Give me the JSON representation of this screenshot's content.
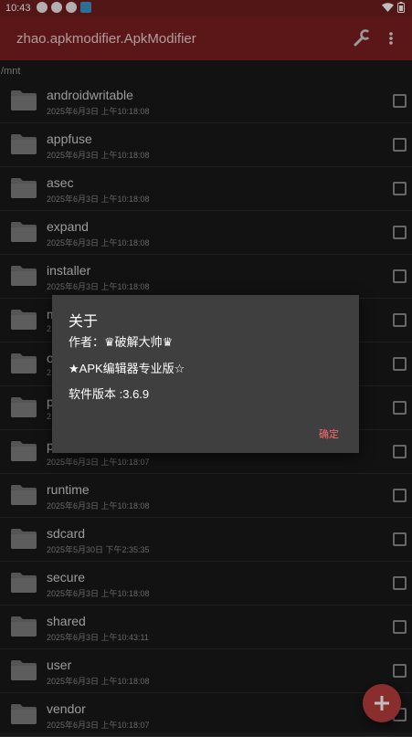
{
  "status_bar": {
    "time": "10:43"
  },
  "app_bar": {
    "title": "zhao.apkmodifier.ApkModifier"
  },
  "path": "/mnt",
  "files": [
    {
      "name": "androidwritable",
      "date": "2025年6月3日 上午10:18:08"
    },
    {
      "name": "appfuse",
      "date": "2025年6月3日 上午10:18:08"
    },
    {
      "name": "asec",
      "date": "2025年6月3日 上午10:18:08"
    },
    {
      "name": "expand",
      "date": "2025年6月3日 上午10:18:08"
    },
    {
      "name": "installer",
      "date": "2025年6月3日 上午10:18:08"
    },
    {
      "name": "m",
      "date": "2"
    },
    {
      "name": "o",
      "date": "2"
    },
    {
      "name": "p",
      "date": "2"
    },
    {
      "name": "p",
      "date": "2025年6月3日 上午10:18:07"
    },
    {
      "name": "runtime",
      "date": "2025年6月3日 上午10:18:08"
    },
    {
      "name": "sdcard",
      "date": "2025年5月30日 下午2:35:35"
    },
    {
      "name": "secure",
      "date": "2025年6月3日 上午10:18:08"
    },
    {
      "name": "shared",
      "date": "2025年6月3日 上午10:43:11"
    },
    {
      "name": "user",
      "date": "2025年6月3日 上午10:18:08"
    },
    {
      "name": "vendor",
      "date": "2025年6月3日 上午10:18:07"
    }
  ],
  "dialog": {
    "title": "关于",
    "author": "作者：♛破解大帅♛",
    "edition": "★APK编辑器专业版☆",
    "version": "软件版本 :3.6.9",
    "ok_label": "确定"
  },
  "colors": {
    "app_bar": "#7a1f1f",
    "status_bar": "#6e1e1e",
    "background": "#181818",
    "dialog": "#3f3f3f",
    "accent": "#ff6a6a",
    "fab": "#b83c3c"
  },
  "icons": [
    "wrench-icon",
    "more-vert-icon",
    "folder-icon",
    "checkbox-icon",
    "plus-icon",
    "wifi-icon",
    "battery-icon"
  ]
}
